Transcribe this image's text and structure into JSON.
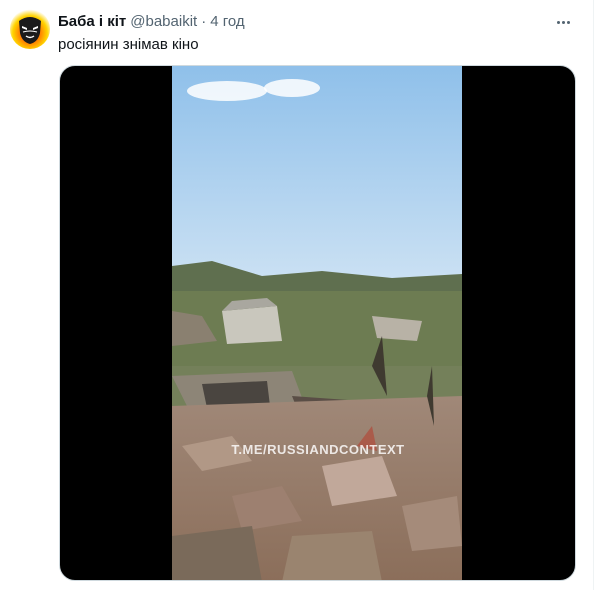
{
  "tweet": {
    "display_name": "Баба і кіт",
    "handle": "@babaikit",
    "separator": "·",
    "time": "4 год",
    "text": "росіянин знімав кіно"
  },
  "media": {
    "watermark": "T.ME/RUSSIANDCONTEXT"
  },
  "icons": {
    "avatar": "avatar-image",
    "more": "more-options-icon"
  },
  "colors": {
    "text_primary": "#0f1419",
    "text_secondary": "#536471",
    "media_background": "#000000"
  }
}
